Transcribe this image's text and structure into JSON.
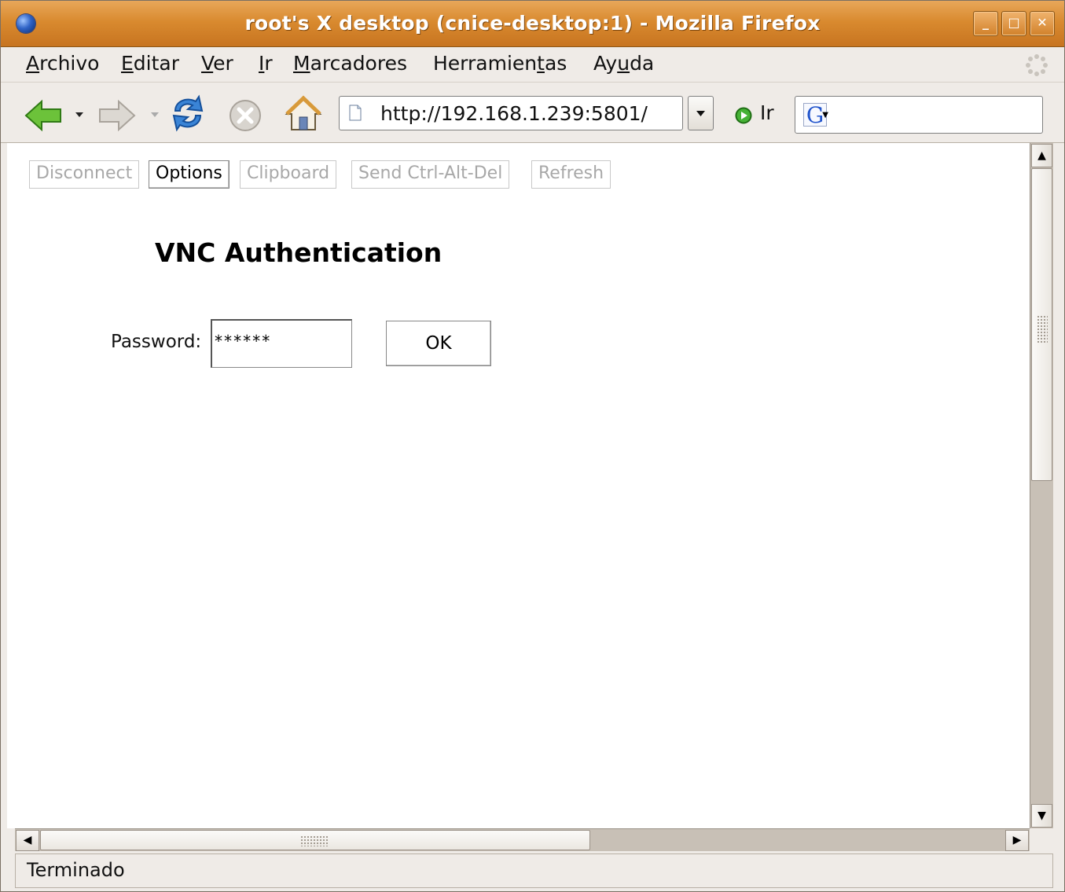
{
  "window": {
    "title": "root's X desktop (cnice-desktop:1) - Mozilla Firefox",
    "buttons": {
      "minimize": "_",
      "maximize": "□",
      "close": "✕"
    }
  },
  "menubar": {
    "items": [
      {
        "label": "Archivo",
        "accel": "A"
      },
      {
        "label": "Editar",
        "accel": "E"
      },
      {
        "label": "Ver",
        "accel": "V"
      },
      {
        "label": "Ir",
        "accel": "I"
      },
      {
        "label": "Marcadores",
        "accel": "M"
      },
      {
        "label": "Herramientas",
        "accel": "t"
      },
      {
        "label": "Ayuda",
        "accel": "u"
      }
    ]
  },
  "navbar": {
    "url": "http://192.168.1.239:5801/",
    "go_label": "Ir",
    "search_engine": "G",
    "search_value": ""
  },
  "applet": {
    "buttons": [
      {
        "label": "Disconnect",
        "enabled": false
      },
      {
        "label": "Options",
        "enabled": true
      },
      {
        "label": "Clipboard",
        "enabled": false
      },
      {
        "label": "Send Ctrl-Alt-Del",
        "enabled": false
      },
      {
        "label": "Refresh",
        "enabled": false
      }
    ],
    "heading": "VNC Authentication",
    "password_label": "Password:",
    "password_value": "******",
    "ok_label": "OK"
  },
  "status": {
    "text": "Terminado"
  },
  "colors": {
    "titlebar": "#d98a2f",
    "chrome": "#efebe7",
    "scrollbar_track": "#c8c0b6"
  }
}
